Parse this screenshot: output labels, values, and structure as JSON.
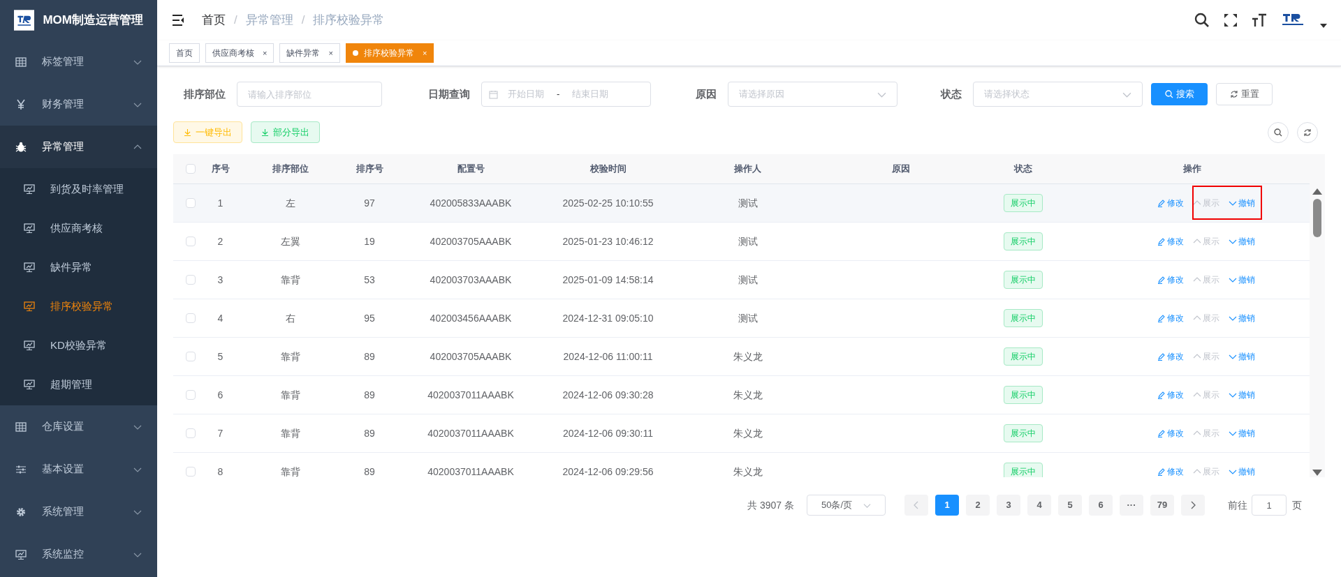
{
  "app": {
    "title": "MOM制造运营管理"
  },
  "sidebar": {
    "items": [
      {
        "label": "标签管理",
        "expanded": false,
        "selected": false
      },
      {
        "label": "财务管理",
        "expanded": false,
        "selected": false
      },
      {
        "label": "异常管理",
        "expanded": true,
        "selected": false,
        "children": [
          {
            "label": "到货及时率管理",
            "selected": false
          },
          {
            "label": "供应商考核",
            "selected": false
          },
          {
            "label": "缺件异常",
            "selected": false
          },
          {
            "label": "排序校验异常",
            "selected": true
          },
          {
            "label": "KD校验异常",
            "selected": false
          },
          {
            "label": "超期管理",
            "selected": false
          }
        ]
      },
      {
        "label": "仓库设置",
        "expanded": false,
        "selected": false
      },
      {
        "label": "基本设置",
        "expanded": false,
        "selected": false
      },
      {
        "label": "系统管理",
        "expanded": false,
        "selected": false
      },
      {
        "label": "系统监控",
        "expanded": false,
        "selected": false
      }
    ]
  },
  "breadcrumb": [
    {
      "label": "首页"
    },
    {
      "separator": "/",
      "label": "异常管理"
    },
    {
      "separator": "/",
      "label": "排序校验异常"
    }
  ],
  "tabs": [
    {
      "label": "首页",
      "selected": false
    },
    {
      "label": "供应商考核",
      "close": "×",
      "selected": false
    },
    {
      "label": "缺件异常",
      "close": "×",
      "selected": false
    },
    {
      "label": "排序校验异常",
      "close": "×",
      "selected": true
    }
  ],
  "filters": {
    "department": {
      "label": "排序部位",
      "placeholder": "请输入排序部位"
    },
    "date": {
      "label": "日期查询",
      "start_placeholder": "开始日期",
      "separator": "-",
      "end_placeholder": "结束日期"
    },
    "reason": {
      "label": "原因",
      "placeholder": "请选择原因"
    },
    "status": {
      "label": "状态",
      "placeholder": "请选择状态"
    },
    "search_button": "搜索",
    "reset_button": "重置"
  },
  "export_buttons": [
    {
      "label": "一键导出",
      "kind": "all"
    },
    {
      "label": "部分导出",
      "kind": "partial"
    }
  ],
  "table": {
    "select_all_checked": false,
    "columns": [
      "序号",
      "排序部位",
      "排序号",
      "配置号",
      "校验时间",
      "操作人",
      "原因",
      "状态",
      "操作"
    ],
    "rows": [
      {
        "checked": false,
        "hovered": true,
        "marked": true,
        "cells": [
          "1",
          "左",
          "97",
          "402005833AAABK",
          "2025-02-25 10:10:55",
          "测试",
          ""
        ],
        "status": "展示中",
        "actions": [
          {
            "kind": "edit",
            "label": "修改",
            "disabled": false
          },
          {
            "kind": "show",
            "label": "展示",
            "disabled": true
          },
          {
            "kind": "revoke",
            "label": "撤销",
            "disabled": false
          }
        ]
      },
      {
        "checked": false,
        "hovered": false,
        "marked": false,
        "cells": [
          "2",
          "左翼",
          "19",
          "402003705AAABK",
          "2025-01-23 10:46:12",
          "测试",
          ""
        ],
        "status": "展示中",
        "actions": [
          {
            "kind": "edit",
            "label": "修改",
            "disabled": false
          },
          {
            "kind": "show",
            "label": "展示",
            "disabled": true
          },
          {
            "kind": "revoke",
            "label": "撤销",
            "disabled": false
          }
        ]
      },
      {
        "checked": false,
        "hovered": false,
        "marked": false,
        "cells": [
          "3",
          "靠背",
          "53",
          "402003703AAABK",
          "2025-01-09 14:58:14",
          "测试",
          ""
        ],
        "status": "展示中",
        "actions": [
          {
            "kind": "edit",
            "label": "修改",
            "disabled": false
          },
          {
            "kind": "show",
            "label": "展示",
            "disabled": true
          },
          {
            "kind": "revoke",
            "label": "撤销",
            "disabled": false
          }
        ]
      },
      {
        "checked": false,
        "hovered": false,
        "marked": false,
        "cells": [
          "4",
          "右",
          "95",
          "402003456AAABK",
          "2024-12-31 09:05:10",
          "测试",
          ""
        ],
        "status": "展示中",
        "actions": [
          {
            "kind": "edit",
            "label": "修改",
            "disabled": false
          },
          {
            "kind": "show",
            "label": "展示",
            "disabled": true
          },
          {
            "kind": "revoke",
            "label": "撤销",
            "disabled": false
          }
        ]
      },
      {
        "checked": false,
        "hovered": false,
        "marked": false,
        "cells": [
          "5",
          "靠背",
          "89",
          "402003705AAABK",
          "2024-12-06 11:00:11",
          "朱义龙",
          ""
        ],
        "status": "展示中",
        "actions": [
          {
            "kind": "edit",
            "label": "修改",
            "disabled": false
          },
          {
            "kind": "show",
            "label": "展示",
            "disabled": true
          },
          {
            "kind": "revoke",
            "label": "撤销",
            "disabled": false
          }
        ]
      },
      {
        "checked": false,
        "hovered": false,
        "marked": false,
        "cells": [
          "6",
          "靠背",
          "89",
          "4020037011AAABK",
          "2024-12-06 09:30:28",
          "朱义龙",
          ""
        ],
        "status": "展示中",
        "actions": [
          {
            "kind": "edit",
            "label": "修改",
            "disabled": false
          },
          {
            "kind": "show",
            "label": "展示",
            "disabled": true
          },
          {
            "kind": "revoke",
            "label": "撤销",
            "disabled": false
          }
        ]
      },
      {
        "checked": false,
        "hovered": false,
        "marked": false,
        "cells": [
          "7",
          "靠背",
          "89",
          "4020037011AAABK",
          "2024-12-06 09:30:11",
          "朱义龙",
          ""
        ],
        "status": "展示中",
        "actions": [
          {
            "kind": "edit",
            "label": "修改",
            "disabled": false
          },
          {
            "kind": "show",
            "label": "展示",
            "disabled": true
          },
          {
            "kind": "revoke",
            "label": "撤销",
            "disabled": false
          }
        ]
      },
      {
        "checked": false,
        "hovered": false,
        "marked": false,
        "cells": [
          "8",
          "靠背",
          "89",
          "4020037011AAABK",
          "2024-12-06 09:29:56",
          "朱义龙",
          ""
        ],
        "status": "展示中",
        "actions": [
          {
            "kind": "edit",
            "label": "修改",
            "disabled": false
          },
          {
            "kind": "show",
            "label": "展示",
            "disabled": true
          },
          {
            "kind": "revoke",
            "label": "撤销",
            "disabled": false
          }
        ]
      }
    ]
  },
  "pagination": {
    "total": "共 3907 条",
    "page_size": "50条/页",
    "pages": [
      {
        "label": "1",
        "selected": true
      },
      {
        "label": "2",
        "selected": false
      },
      {
        "label": "3",
        "selected": false
      },
      {
        "label": "4",
        "selected": false
      },
      {
        "label": "5",
        "selected": false
      },
      {
        "label": "6",
        "selected": false
      },
      {
        "label": "···",
        "selected": false
      },
      {
        "label": "79",
        "selected": false
      }
    ],
    "goto_label": "前往",
    "goto_value": "1",
    "goto_suffix": "页"
  }
}
